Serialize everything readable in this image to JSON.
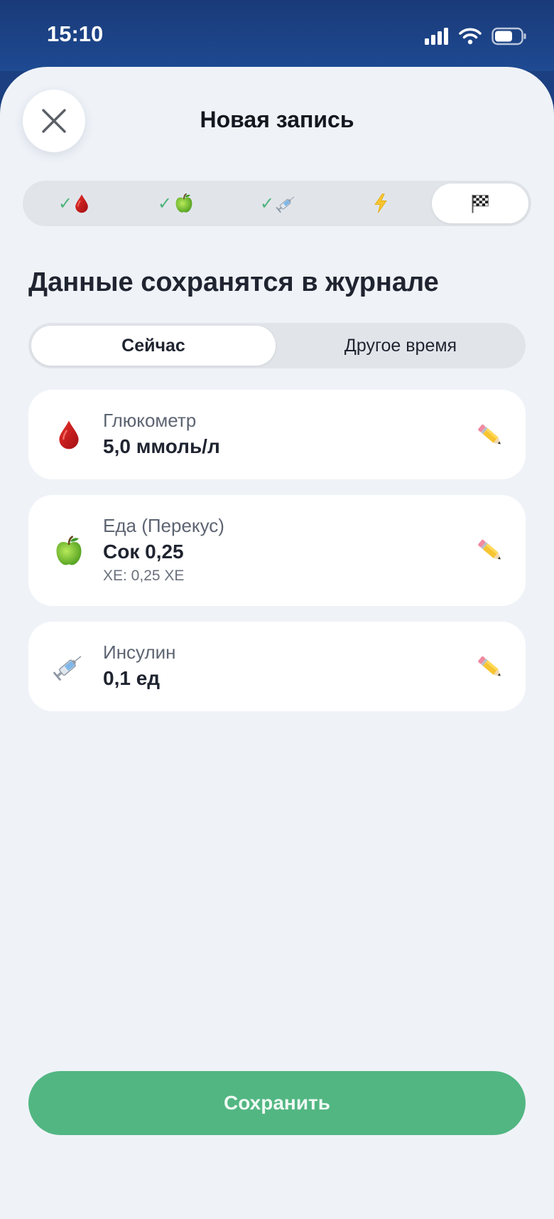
{
  "status_bar": {
    "time": "15:10"
  },
  "header": {
    "title": "Новая запись",
    "close_icon": "close-icon"
  },
  "steps": [
    {
      "icon": "blood-drop-icon",
      "done": true
    },
    {
      "icon": "green-apple-icon",
      "done": true
    },
    {
      "icon": "syringe-icon",
      "done": true
    },
    {
      "icon": "lightning-icon",
      "done": false
    },
    {
      "icon": "checkered-flag-icon",
      "done": false,
      "active": true
    }
  ],
  "heading": "Данные сохранятся в журнале",
  "time_toggle": {
    "now": "Сейчас",
    "other": "Другое время",
    "selected": "now"
  },
  "entries": [
    {
      "icon": "blood-drop-icon",
      "label": "Глюкометр",
      "value": "5,0 ммоль/л"
    },
    {
      "icon": "green-apple-icon",
      "label": "Еда (Перекус)",
      "value": "Сок 0,25",
      "sub": "ХЕ: 0,25 ХЕ"
    },
    {
      "icon": "syringe-icon",
      "label": "Инсулин",
      "value": "0,1 ед"
    }
  ],
  "save_label": "Сохранить",
  "colors": {
    "accent": "#52b682",
    "header": "#1b3f80",
    "background": "#eff3f8"
  }
}
